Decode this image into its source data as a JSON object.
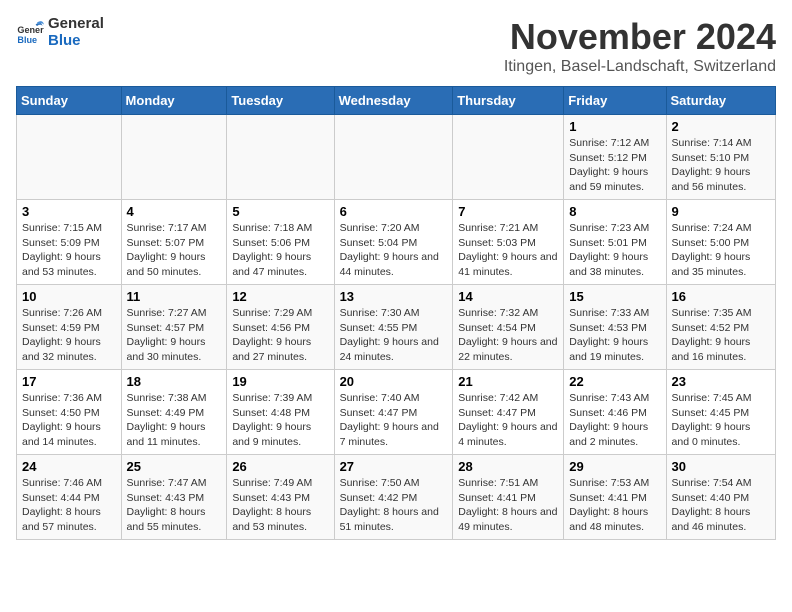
{
  "header": {
    "logo_line1": "General",
    "logo_line2": "Blue",
    "month_year": "November 2024",
    "location": "Itingen, Basel-Landschaft, Switzerland"
  },
  "days_of_week": [
    "Sunday",
    "Monday",
    "Tuesday",
    "Wednesday",
    "Thursday",
    "Friday",
    "Saturday"
  ],
  "weeks": [
    [
      {
        "day": "",
        "info": ""
      },
      {
        "day": "",
        "info": ""
      },
      {
        "day": "",
        "info": ""
      },
      {
        "day": "",
        "info": ""
      },
      {
        "day": "",
        "info": ""
      },
      {
        "day": "1",
        "info": "Sunrise: 7:12 AM\nSunset: 5:12 PM\nDaylight: 9 hours and 59 minutes."
      },
      {
        "day": "2",
        "info": "Sunrise: 7:14 AM\nSunset: 5:10 PM\nDaylight: 9 hours and 56 minutes."
      }
    ],
    [
      {
        "day": "3",
        "info": "Sunrise: 7:15 AM\nSunset: 5:09 PM\nDaylight: 9 hours and 53 minutes."
      },
      {
        "day": "4",
        "info": "Sunrise: 7:17 AM\nSunset: 5:07 PM\nDaylight: 9 hours and 50 minutes."
      },
      {
        "day": "5",
        "info": "Sunrise: 7:18 AM\nSunset: 5:06 PM\nDaylight: 9 hours and 47 minutes."
      },
      {
        "day": "6",
        "info": "Sunrise: 7:20 AM\nSunset: 5:04 PM\nDaylight: 9 hours and 44 minutes."
      },
      {
        "day": "7",
        "info": "Sunrise: 7:21 AM\nSunset: 5:03 PM\nDaylight: 9 hours and 41 minutes."
      },
      {
        "day": "8",
        "info": "Sunrise: 7:23 AM\nSunset: 5:01 PM\nDaylight: 9 hours and 38 minutes."
      },
      {
        "day": "9",
        "info": "Sunrise: 7:24 AM\nSunset: 5:00 PM\nDaylight: 9 hours and 35 minutes."
      }
    ],
    [
      {
        "day": "10",
        "info": "Sunrise: 7:26 AM\nSunset: 4:59 PM\nDaylight: 9 hours and 32 minutes."
      },
      {
        "day": "11",
        "info": "Sunrise: 7:27 AM\nSunset: 4:57 PM\nDaylight: 9 hours and 30 minutes."
      },
      {
        "day": "12",
        "info": "Sunrise: 7:29 AM\nSunset: 4:56 PM\nDaylight: 9 hours and 27 minutes."
      },
      {
        "day": "13",
        "info": "Sunrise: 7:30 AM\nSunset: 4:55 PM\nDaylight: 9 hours and 24 minutes."
      },
      {
        "day": "14",
        "info": "Sunrise: 7:32 AM\nSunset: 4:54 PM\nDaylight: 9 hours and 22 minutes."
      },
      {
        "day": "15",
        "info": "Sunrise: 7:33 AM\nSunset: 4:53 PM\nDaylight: 9 hours and 19 minutes."
      },
      {
        "day": "16",
        "info": "Sunrise: 7:35 AM\nSunset: 4:52 PM\nDaylight: 9 hours and 16 minutes."
      }
    ],
    [
      {
        "day": "17",
        "info": "Sunrise: 7:36 AM\nSunset: 4:50 PM\nDaylight: 9 hours and 14 minutes."
      },
      {
        "day": "18",
        "info": "Sunrise: 7:38 AM\nSunset: 4:49 PM\nDaylight: 9 hours and 11 minutes."
      },
      {
        "day": "19",
        "info": "Sunrise: 7:39 AM\nSunset: 4:48 PM\nDaylight: 9 hours and 9 minutes."
      },
      {
        "day": "20",
        "info": "Sunrise: 7:40 AM\nSunset: 4:47 PM\nDaylight: 9 hours and 7 minutes."
      },
      {
        "day": "21",
        "info": "Sunrise: 7:42 AM\nSunset: 4:47 PM\nDaylight: 9 hours and 4 minutes."
      },
      {
        "day": "22",
        "info": "Sunrise: 7:43 AM\nSunset: 4:46 PM\nDaylight: 9 hours and 2 minutes."
      },
      {
        "day": "23",
        "info": "Sunrise: 7:45 AM\nSunset: 4:45 PM\nDaylight: 9 hours and 0 minutes."
      }
    ],
    [
      {
        "day": "24",
        "info": "Sunrise: 7:46 AM\nSunset: 4:44 PM\nDaylight: 8 hours and 57 minutes."
      },
      {
        "day": "25",
        "info": "Sunrise: 7:47 AM\nSunset: 4:43 PM\nDaylight: 8 hours and 55 minutes."
      },
      {
        "day": "26",
        "info": "Sunrise: 7:49 AM\nSunset: 4:43 PM\nDaylight: 8 hours and 53 minutes."
      },
      {
        "day": "27",
        "info": "Sunrise: 7:50 AM\nSunset: 4:42 PM\nDaylight: 8 hours and 51 minutes."
      },
      {
        "day": "28",
        "info": "Sunrise: 7:51 AM\nSunset: 4:41 PM\nDaylight: 8 hours and 49 minutes."
      },
      {
        "day": "29",
        "info": "Sunrise: 7:53 AM\nSunset: 4:41 PM\nDaylight: 8 hours and 48 minutes."
      },
      {
        "day": "30",
        "info": "Sunrise: 7:54 AM\nSunset: 4:40 PM\nDaylight: 8 hours and 46 minutes."
      }
    ]
  ]
}
